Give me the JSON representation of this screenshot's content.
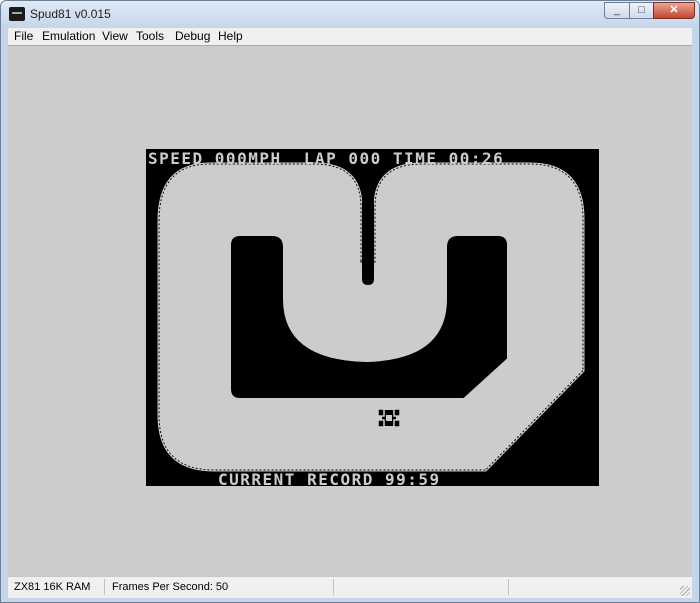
{
  "window": {
    "title": "Spud81 v0.015",
    "minimize": "0",
    "maximize": "1",
    "close": "r"
  },
  "menu": [
    "File",
    "Emulation",
    "View",
    "Tools",
    "Debug",
    "Help"
  ],
  "game": {
    "hud_top": "SPEED 000MPH  LAP 000 TIME 00:26",
    "hud_bottom": "CURRENT RECORD 99:59"
  },
  "status": {
    "machine": "ZX81 16K RAM",
    "fps": "Frames Per Second: 50"
  },
  "colors": {
    "screen": "#000000",
    "track": "#cccccc",
    "client": "#cccccc"
  }
}
